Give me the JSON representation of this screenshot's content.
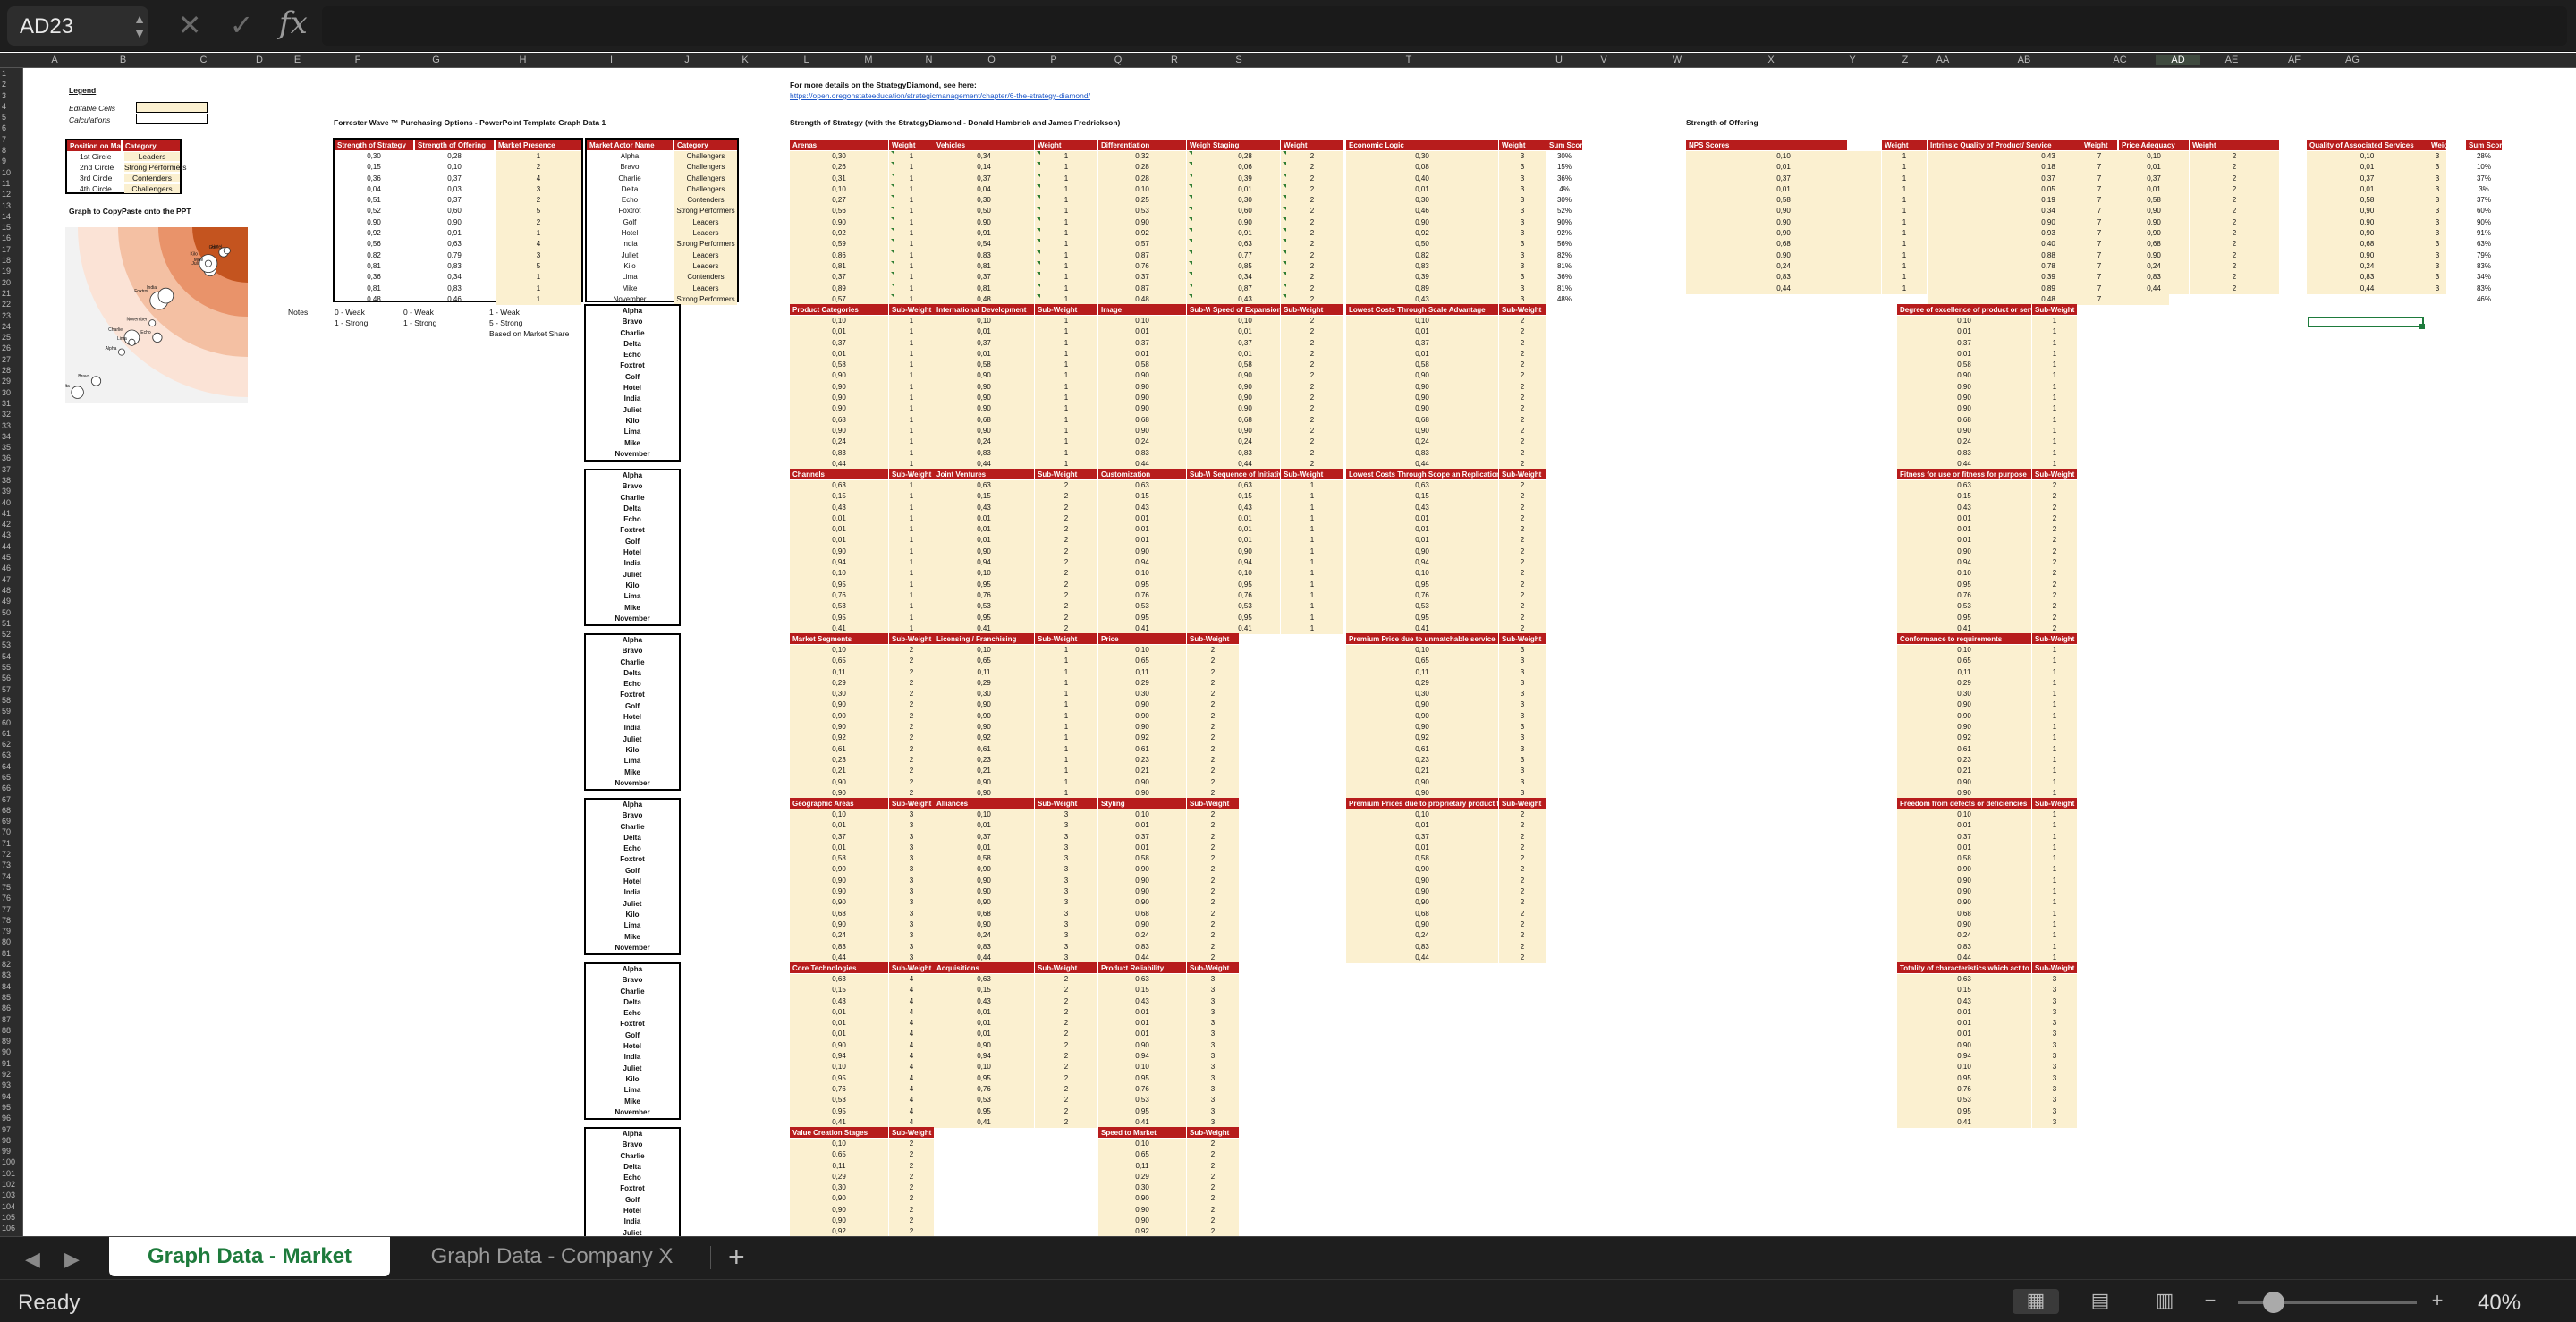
{
  "formula_bar": {
    "name_box": "AD23",
    "cancel_icon": "✕",
    "enter_icon": "✓",
    "fx_label": "fx",
    "formula": ""
  },
  "columns": [
    "A",
    "B",
    "C",
    "D",
    "E",
    "F",
    "G",
    "H",
    "I",
    "J",
    "K",
    "L",
    "M",
    "N",
    "O",
    "P",
    "Q",
    "R",
    "S",
    "T",
    "U",
    "V",
    "W",
    "X",
    "Y",
    "Z",
    "AA",
    "AB",
    "AC",
    "AD",
    "AE",
    "AF",
    "AG"
  ],
  "selected_column": "AD",
  "legend": {
    "title": "Legend",
    "editable": "Editable Cells",
    "calculations": "Calculations",
    "graph_note": "Graph to CopyPaste onto the PPT"
  },
  "circle_table": {
    "headers": [
      "Position on Matrix",
      "Category"
    ],
    "rows": [
      [
        "1st Circle",
        "Leaders"
      ],
      [
        "2nd Circle",
        "Strong Performers"
      ],
      [
        "3rd Circle",
        "Contenders"
      ],
      [
        "4th Circle",
        "Challengers"
      ]
    ]
  },
  "forrester": {
    "title": "Forrester Wave ™ Purchasing Options - PowerPoint Template Graph Data 1",
    "headers": [
      "Strength of Strategy",
      "Strength of Offering",
      "Market Presence",
      "Market Actor Name",
      "Category"
    ],
    "strategy": [
      "0,30",
      "0,15",
      "0,36",
      "0,04",
      "0,51",
      "0,52",
      "0,90",
      "0,92",
      "0,56",
      "0,82",
      "0,81",
      "0,36",
      "0,81",
      "0,48"
    ],
    "offering": [
      "0,28",
      "0,10",
      "0,37",
      "0,03",
      "0,37",
      "0,60",
      "0,90",
      "0,91",
      "0,63",
      "0,79",
      "0,83",
      "0,34",
      "0,83",
      "0,46"
    ],
    "presence": [
      "1",
      "2",
      "4",
      "3",
      "2",
      "5",
      "2",
      "1",
      "4",
      "3",
      "5",
      "1",
      "1",
      "1"
    ],
    "names": [
      "Alpha",
      "Bravo",
      "Charlie",
      "Delta",
      "Echo",
      "Foxtrot",
      "Golf",
      "Hotel",
      "India",
      "Juliet",
      "Kilo",
      "Lima",
      "Mike",
      "November"
    ],
    "category": [
      "Challengers",
      "Challengers",
      "Challengers",
      "Challengers",
      "Contenders",
      "Strong Performers",
      "Leaders",
      "Leaders",
      "Strong Performers",
      "Leaders",
      "Leaders",
      "Contenders",
      "Leaders",
      "Strong Performers"
    ]
  },
  "notes": {
    "label": "Notes:",
    "n1": [
      "0 - Weak",
      "1 - Strong"
    ],
    "n2": [
      "0 - Weak",
      "1 - Strong"
    ],
    "n3": [
      "1 - Weak",
      "5 - Strong",
      "Based on Market Share"
    ]
  },
  "strategy_diamond": {
    "title": "Strength of Strategy (with the StrategyDiamond - Donald Hambrick and James Fredrickson)",
    "more_info": "For more details on the StrategyDiamond, see here:",
    "url": "https://open.oregonstateeducation/strategicmanagement/chapter/6-the-strategy-diamond/",
    "top_headers": [
      "Arenas",
      "Weight",
      "Vehicles",
      "Weight",
      "Differentiation",
      "Weight",
      "Staging",
      "Weight",
      "Economic Logic",
      "Weight",
      "Sum Score"
    ],
    "arenas": [
      "0,30",
      "0,26",
      "0,31",
      "0,10",
      "0,27",
      "0,56",
      "0,90",
      "0,92",
      "0,59",
      "0,86",
      "0,81",
      "0,37",
      "0,89",
      "0,57"
    ],
    "arenas_w": [
      "1",
      "1",
      "1",
      "1",
      "1",
      "1",
      "1",
      "1",
      "1",
      "1",
      "1",
      "1",
      "1",
      "1"
    ],
    "vehicles": [
      "0,34",
      "0,14",
      "0,37",
      "0,04",
      "0,30",
      "0,50",
      "0,90",
      "0,91",
      "0,54",
      "0,83",
      "0,81",
      "0,37",
      "0,81",
      "0,48"
    ],
    "vehicles_w": [
      "1",
      "1",
      "1",
      "1",
      "1",
      "1",
      "1",
      "1",
      "1",
      "1",
      "1",
      "1",
      "1",
      "1"
    ],
    "diff": [
      "0,32",
      "0,28",
      "0,28",
      "0,10",
      "0,25",
      "0,53",
      "0,90",
      "0,92",
      "0,57",
      "0,87",
      "0,76",
      "0,37",
      "0,87",
      "0,48"
    ],
    "diff_w": [
      "2",
      "2",
      "2",
      "2",
      "2",
      "2",
      "2",
      "2",
      "2",
      "2",
      "2",
      "2",
      "2",
      "2"
    ],
    "staging": [
      "0,28",
      "0,06",
      "0,39",
      "0,01",
      "0,30",
      "0,60",
      "0,90",
      "0,91",
      "0,63",
      "0,77",
      "0,85",
      "0,34",
      "0,87",
      "0,43"
    ],
    "staging_w": [
      "2",
      "2",
      "2",
      "2",
      "2",
      "2",
      "2",
      "2",
      "2",
      "2",
      "2",
      "2",
      "2",
      "2"
    ],
    "econ": [
      "0,30",
      "0,08",
      "0,40",
      "0,01",
      "0,30",
      "0,46",
      "0,90",
      "0,92",
      "0,50",
      "0,82",
      "0,83",
      "0,39",
      "0,89",
      "0,43"
    ],
    "econ_w": [
      "3",
      "3",
      "3",
      "3",
      "3",
      "3",
      "3",
      "3",
      "3",
      "3",
      "3",
      "3",
      "3",
      "3"
    ],
    "sum": [
      "30%",
      "15%",
      "36%",
      "4%",
      "30%",
      "52%",
      "90%",
      "92%",
      "56%",
      "82%",
      "81%",
      "36%",
      "81%",
      "48%"
    ]
  },
  "offering_block": {
    "title": "Strength of Offering",
    "headers": [
      "NPS Scores",
      "Weight",
      "Intrinsic Quality of Product/ Service",
      "Weight",
      "Price Adequacy",
      "Weight",
      "Quality of Associated Services",
      "Weight",
      "Sum Score"
    ],
    "nps": [
      "0,10",
      "0,01",
      "0,37",
      "0,01",
      "0,58",
      "0,90",
      "0,90",
      "0,90",
      "0,68",
      "0,90",
      "0,24",
      "0,83",
      "0,44"
    ],
    "nps_w": [
      "1",
      "1",
      "1",
      "1",
      "1",
      "1",
      "1",
      "1",
      "1",
      "1",
      "1",
      "1",
      "1"
    ],
    "iq": [
      "0,43",
      "0,18",
      "0,37",
      "0,05",
      "0,19",
      "0,34",
      "0,90",
      "0,93",
      "0,40",
      "0,88",
      "0,78",
      "0,39",
      "0,89",
      "0,48"
    ],
    "iq_w": [
      "7",
      "7",
      "7",
      "7",
      "7",
      "7",
      "7",
      "7",
      "7",
      "7",
      "7",
      "7",
      "7",
      "7"
    ],
    "pa": [
      "0,10",
      "0,01",
      "0,37",
      "0,01",
      "0,58",
      "0,90",
      "0,90",
      "0,90",
      "0,68",
      "0,90",
      "0,24",
      "0,83",
      "0,44"
    ],
    "pa_w": [
      "2",
      "2",
      "2",
      "2",
      "2",
      "2",
      "2",
      "2",
      "2",
      "2",
      "2",
      "2",
      "2"
    ],
    "qa": [
      "0,10",
      "0,01",
      "0,37",
      "0,01",
      "0,58",
      "0,90",
      "0,90",
      "0,90",
      "0,68",
      "0,90",
      "0,24",
      "0,83",
      "0,44"
    ],
    "qa_w": [
      "3",
      "3",
      "3",
      "3",
      "3",
      "3",
      "3",
      "3",
      "3",
      "3",
      "3",
      "3",
      "3"
    ],
    "sum": [
      "28%",
      "10%",
      "37%",
      "3%",
      "37%",
      "60%",
      "90%",
      "91%",
      "63%",
      "79%",
      "83%",
      "34%",
      "83%",
      "46%"
    ]
  },
  "sub_tables": {
    "names": [
      "Alpha",
      "Bravo",
      "Charlie",
      "Delta",
      "Echo",
      "Foxtrot",
      "Golf",
      "Hotel",
      "India",
      "Juliet",
      "Kilo",
      "Lima",
      "Mike",
      "November"
    ],
    "sub_weight": "Sub-Weight",
    "block_a_vals": [
      "0,10",
      "0,01",
      "0,37",
      "0,01",
      "0,58",
      "0,90",
      "0,90",
      "0,90",
      "0,90",
      "0,68",
      "0,90",
      "0,24",
      "0,83",
      "0,44"
    ],
    "block_b_vals": [
      "0,63",
      "0,15",
      "0,43",
      "0,01",
      "0,01",
      "0,01",
      "0,90",
      "0,94",
      "0,10",
      "0,95",
      "0,76",
      "0,53",
      "0,95",
      "0,41"
    ],
    "block_c_vals": [
      "0,10",
      "0,65",
      "0,11",
      "0,29",
      "0,30",
      "0,90",
      "0,90",
      "0,90",
      "0,92",
      "0,61",
      "0,23",
      "0,21",
      "0,90",
      "0,90"
    ],
    "rows": [
      {
        "labels": [
          "Product Categories",
          "International Development",
          "Image",
          "Speed of Expansion",
          "Lowest Costs Through Scale Advantage",
          "Degree of excellence of product or service"
        ],
        "w": [
          "1",
          "1",
          "1",
          "2",
          "2",
          "1"
        ],
        "src": "a"
      },
      {
        "labels": [
          "Channels",
          "Joint Ventures",
          "Customization",
          "Sequence of Initiatives",
          "Lowest Costs Through Scope an Replication Advantage",
          "Fitness for use or fitness for purpose"
        ],
        "w": [
          "1",
          "2",
          "2",
          "1",
          "2",
          "2"
        ],
        "src": "b"
      },
      {
        "labels": [
          "Market Segments",
          "Licensing / Franchising",
          "Price",
          "",
          "Premium Price due to unmatchable service",
          "Conformance to requirements"
        ],
        "w": [
          "2",
          "1",
          "2",
          "",
          "3",
          "1"
        ],
        "src": "c"
      },
      {
        "labels": [
          "Geographic Areas",
          "Alliances",
          "Styling",
          "",
          "Premium Prices due to proprietary product features",
          "Freedom from defects or deficiencies"
        ],
        "w": [
          "3",
          "3",
          "2",
          "",
          "2",
          "1"
        ],
        "src": "a"
      },
      {
        "labels": [
          "Core Technologies",
          "Acquisitions",
          "Product Reliability",
          "",
          "",
          "Totality of characteristics which act to satisfy a need"
        ],
        "w": [
          "4",
          "2",
          "3",
          "",
          "",
          "3"
        ],
        "src": "b"
      },
      {
        "labels": [
          "Value Creation Stages",
          "",
          "Speed to Market",
          "",
          "",
          ""
        ],
        "w": [
          "2",
          "",
          "2",
          "",
          "",
          ""
        ],
        "src": "c"
      }
    ]
  },
  "sheet_tabs": {
    "active": "Graph Data - Market",
    "other": "Graph Data - Company X",
    "add": "+"
  },
  "status_bar": {
    "status": "Ready",
    "zoom": "40%",
    "zoom_value": 0.4,
    "minus": "−",
    "plus": "+"
  },
  "bubble_chart_labels": {
    "alpha": "Alpha",
    "bravo": "Bravo",
    "charlie": "Charlie",
    "delta": "Delta",
    "echo": "Echo",
    "foxtrot": "Foxtrot",
    "golf": "Golf",
    "hotel": "Hotel",
    "india": "India",
    "juliet": "Juliet",
    "kilo": "Kilo",
    "lima": "Lima",
    "mike": "Mike",
    "november": "November"
  }
}
